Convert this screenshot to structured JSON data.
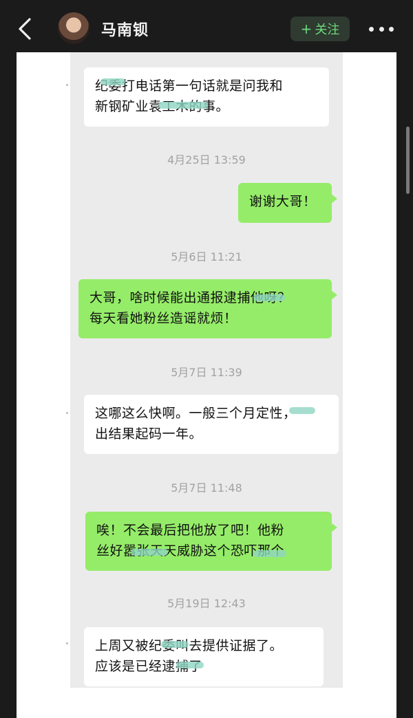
{
  "header": {
    "back_icon": "chevron-left-icon",
    "avatar_icon": "avatar",
    "account_name": "马南钡",
    "follow_plus": "+",
    "follow_label": "关注",
    "more_icon": "more-horizontal-icon"
  },
  "chat": {
    "messages": [
      {
        "side": "in",
        "lines": [
          "纪委打电话第一句话就是问我和",
          "新钢矿业袁工木的事。"
        ]
      },
      {
        "side": "time",
        "text": "4月25日 13:59"
      },
      {
        "side": "out",
        "lines": [
          "谢谢大哥！"
        ]
      },
      {
        "side": "time",
        "text": "5月6日 11:21"
      },
      {
        "side": "out",
        "lines": [
          "大哥，啥时候能出通报逮捕他呀？",
          "每天看她粉丝造谣就烦！"
        ]
      },
      {
        "side": "time",
        "text": "5月7日 11:39"
      },
      {
        "side": "in",
        "lines": [
          "这哪这么快啊。一般三个月定性，",
          "出结果起码一年。"
        ]
      },
      {
        "side": "time",
        "text": "5月7日 11:48"
      },
      {
        "side": "out",
        "lines": [
          "唉！不会最后把他放了吧！他粉",
          "丝好嚣张天天威胁这个恐吓那个"
        ]
      },
      {
        "side": "time",
        "text": "5月19日 12:43"
      },
      {
        "side": "in",
        "lines": [
          "上周又被纪委叫去提供证据了。",
          "应该是已经逮捕了"
        ]
      }
    ]
  },
  "colors": {
    "outgoing_bubble": "#95ec69",
    "incoming_bubble": "#ffffff",
    "chat_background": "#ebebeb",
    "follow_text": "#6ddb79"
  }
}
